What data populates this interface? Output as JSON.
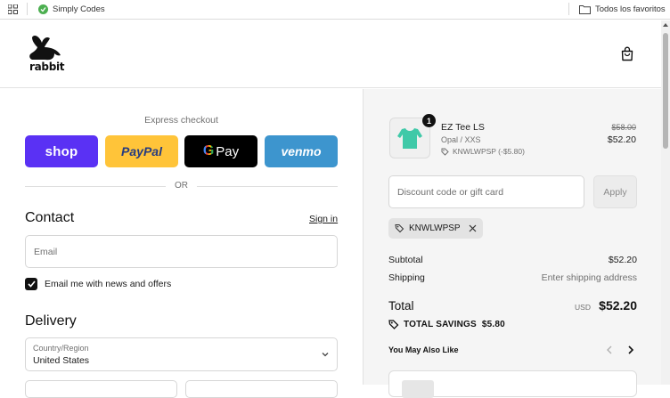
{
  "bookmarks": {
    "simply_codes": "Simply Codes",
    "all_favorites": "Todos los favoritos"
  },
  "brand": {
    "logo_text": "rabbit"
  },
  "express": {
    "label": "Express checkout",
    "shop": "shop",
    "paypal": "PayPal",
    "gpay": "Pay",
    "venmo": "venmo",
    "or": "OR"
  },
  "contact": {
    "title": "Contact",
    "sign_in": "Sign in",
    "email_placeholder": "Email",
    "newsletter_label": "Email me with news and offers"
  },
  "delivery": {
    "title": "Delivery",
    "country_label": "Country/Region",
    "country_value": "United States"
  },
  "cart": {
    "quantity": "1",
    "item_name": "EZ Tee LS",
    "item_variant": "Opal / XXS",
    "item_discount": "KNWLWPSP (-$5.80)",
    "price_original": "$58.00",
    "price_final": "$52.20",
    "thumb_color": "#3fc9a8"
  },
  "discount": {
    "placeholder": "Discount code or gift card",
    "apply": "Apply",
    "applied_code": "KNWLWPSP"
  },
  "summary": {
    "subtotal_label": "Subtotal",
    "subtotal_value": "$52.20",
    "shipping_label": "Shipping",
    "shipping_value": "Enter shipping address",
    "total_label": "Total",
    "currency": "USD",
    "total_value": "$52.20",
    "savings": "TOTAL SAVINGS  $5.80"
  },
  "recommendations": {
    "title": "You May Also Like"
  },
  "colors": {
    "shop": "#5a31f4",
    "paypal": "#ffc439",
    "gpay": "#000000",
    "venmo": "#3d95ce"
  }
}
